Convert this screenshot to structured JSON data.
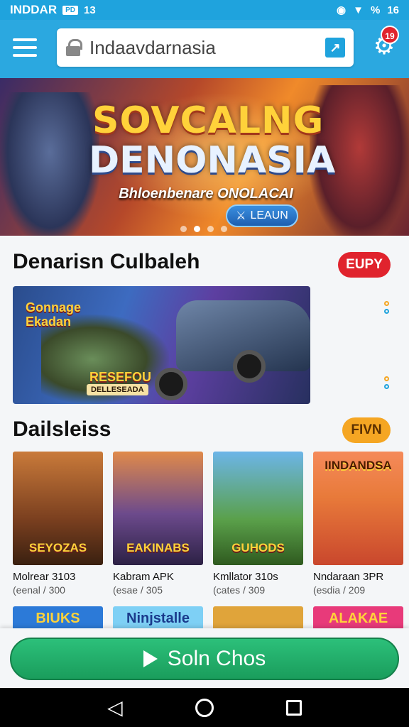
{
  "status_bar": {
    "carrier": "INDDAR",
    "tag": "PD",
    "extra": "13",
    "battery": "%",
    "time": "16"
  },
  "header": {
    "search_value": "Indaavdarnasia",
    "notification_count": "19"
  },
  "hero": {
    "title_line1": "SOVCALNG",
    "title_line2": "DENONASIA",
    "subtitle": "Bhloenbenare ONOLACAI",
    "button_label": "LEAUN",
    "slide_count": 4,
    "active_slide": 2
  },
  "section_featured": {
    "title": "Denarisn Culbaleh",
    "pill": "EUPY",
    "banner_logo": "Gonnage Ekadan",
    "banner_badge": "RESEFOU",
    "banner_sub": "DELLESEADA"
  },
  "section_daily": {
    "title": "Dailsleiss",
    "pill": "FIVN",
    "cards": [
      {
        "thumb_label": "SEYOZAS",
        "name": "Molrear 3103",
        "meta": "(eenal / 300"
      },
      {
        "thumb_label": "EAKINABS",
        "name": "Kabram APK",
        "meta": "(esae / 305"
      },
      {
        "thumb_label": "GUHODS",
        "name": "Kmllator 310s",
        "meta": "(cates / 309"
      },
      {
        "thumb_label": "IINDANDSA",
        "name": "Nndaraan 3PR",
        "meta": "(esdia / 209"
      }
    ],
    "second_row": [
      "BIUKS",
      "Ninjstalle",
      "",
      "ALAKAE"
    ]
  },
  "cta": {
    "label": "Soln Chos"
  },
  "colors": {
    "primary": "#2ba8e0",
    "accent_red": "#e0232d",
    "accent_orange": "#f5a623",
    "cta_green": "#1a9d5c"
  }
}
